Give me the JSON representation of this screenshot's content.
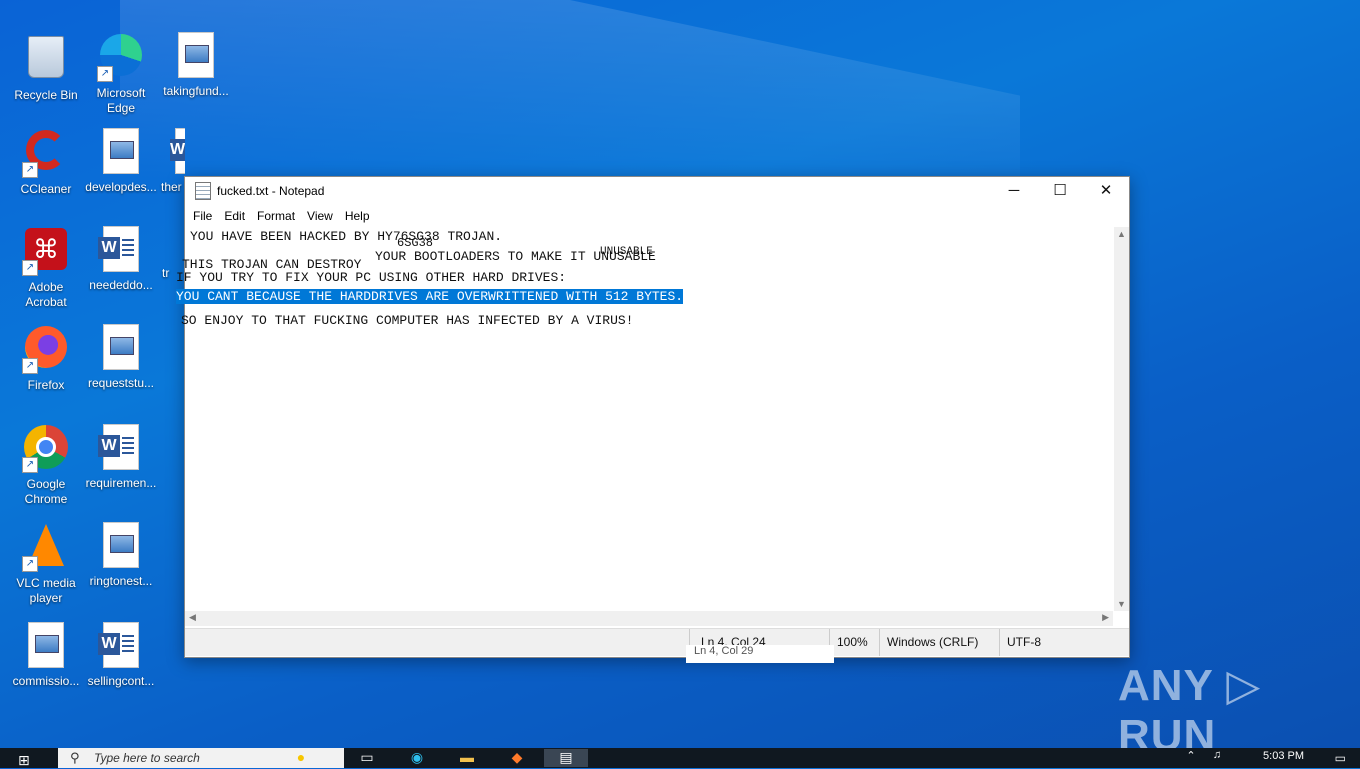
{
  "desktop": {
    "icons": [
      {
        "label": "Recycle Bin",
        "icon": "recycle-bin-icon"
      },
      {
        "label": "Microsoft Edge",
        "icon": "edge-icon"
      },
      {
        "label": "takingfund...",
        "icon": "image-file-icon"
      },
      {
        "label": "CCleaner",
        "icon": "ccleaner-icon"
      },
      {
        "label": "developdes...",
        "icon": "image-file-icon"
      },
      {
        "label": "ther",
        "icon": "word-doc-icon"
      },
      {
        "label": "Adobe Acrobat",
        "icon": "acrobat-icon"
      },
      {
        "label": "neededdo...",
        "icon": "word-doc-icon"
      },
      {
        "label": "tr",
        "icon": "image-file-icon"
      },
      {
        "label": "Firefox",
        "icon": "firefox-icon"
      },
      {
        "label": "requeststu...",
        "icon": "image-file-icon"
      },
      {
        "label": "Google Chrome",
        "icon": "chrome-icon"
      },
      {
        "label": "requiremen...",
        "icon": "word-doc-icon"
      },
      {
        "label": "VLC media player",
        "icon": "vlc-icon"
      },
      {
        "label": "ringtonest...",
        "icon": "image-file-icon"
      },
      {
        "label": "commissio...",
        "icon": "image-file-icon"
      },
      {
        "label": "sellingcont...",
        "icon": "word-doc-icon"
      }
    ]
  },
  "notepad": {
    "title": "fucked.txt - Notepad",
    "buttons": {
      "minimize": "─",
      "maximize": "☐",
      "close": "✕"
    },
    "menu": [
      "File",
      "Edit",
      "Format",
      "View",
      "Help"
    ],
    "lines": [
      "YOU HAVE BEEN HACKED BY HY76SG38 TROJAN.",
      "THIS TROJAN CAN DESTROY",
      "YOUR BOOTLOADERS TO MAKE IT UNUSABLE",
      "IF YOU TRY TO FIX YOUR PC USING OTHER HARD DRIVES:",
      "YOU CANT BECAUSE THE HARDDRIVES ARE OVERWRITTENED WITH 512 BYTES.",
      "SO ENJOY TO THAT FUCKING COMPUTER HAS INFECTED BY A VIRUS!"
    ],
    "glitch_fragments": [
      "6SG38",
      "UNUSABLE",
      "Ln 4, Col 29",
      "T UNUSABLE"
    ],
    "status": {
      "position": "Ln 4, Col 24",
      "zoom": "100%",
      "line_ending": "Windows (CRLF)",
      "encoding": "UTF-8"
    }
  },
  "watermark": "ANY ▷ RUN",
  "taskbar": {
    "start_icon": "windows-logo-icon",
    "search_placeholder": "Type here to search",
    "clock_time": "5:03 PM"
  }
}
